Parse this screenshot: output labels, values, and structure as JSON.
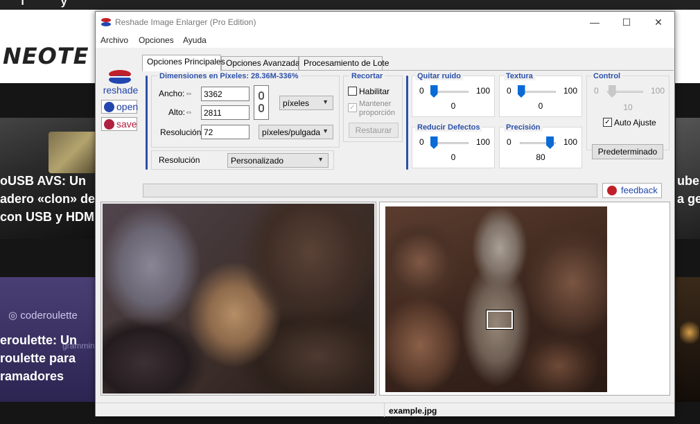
{
  "background": {
    "site_logo": "NEOTE",
    "social": "f y",
    "cards": [
      {
        "lines": [
          "oUSB AVS: Un",
          "adero «clon» de",
          "con USB y HDM"
        ]
      },
      {
        "brand": "coderoulette",
        "lines": [
          "eroulette: Un",
          "roulette para",
          "ramadores"
        ],
        "sub": "gramming game for dev"
      },
      {
        "lines": [
          "ube:",
          "a ger"
        ]
      }
    ]
  },
  "window": {
    "title": "Reshade Image Enlarger (Pro Edition)",
    "controls": {
      "minimize": "—",
      "maximize": "☐",
      "close": "✕"
    }
  },
  "menu": [
    "Archivo",
    "Opciones",
    "Ayuda"
  ],
  "sidebar": {
    "brand": "reshade",
    "open_label": "open",
    "save_label": "save"
  },
  "tabs": [
    "Opciones Principales",
    "Opciones Avanzadas",
    "Procesamiento de Lote"
  ],
  "dimensions": {
    "title": "Dimensiones en Píxeles:  28.36M-336%",
    "width_label": "Ancho:",
    "width_value": "3362",
    "height_label": "Alto:",
    "height_value": "2811",
    "resolution_label": "Resolución",
    "resolution_value": "72",
    "unit": "píxeles",
    "res_unit": "píxeles/pulgada",
    "preset_label": "Resolución",
    "preset_value": "Personalizado"
  },
  "crop": {
    "title": "Recortar",
    "enable_label": "Habilitar",
    "keep_label_1": "Mantener",
    "keep_label_2": "proporción",
    "restore_label": "Restaurar"
  },
  "sliders": [
    {
      "title": "Quitar ruido",
      "min": "0",
      "max": "100",
      "value": "0",
      "fraction": 0.0
    },
    {
      "title": "Textura",
      "min": "0",
      "max": "100",
      "value": "0",
      "fraction": 0.0
    },
    {
      "title": "Control",
      "min": "0",
      "max": "100",
      "value": "10",
      "fraction": 0.1
    },
    {
      "title": "Reducir Defectos",
      "min": "0",
      "max": "100",
      "value": "0",
      "fraction": 0.0
    },
    {
      "title": "Precisión",
      "min": "0",
      "max": "100",
      "value": "80",
      "fraction": 0.8
    }
  ],
  "control": {
    "auto_label": "Auto Ajuste",
    "default_label": "Predeterminado"
  },
  "feedback_label": "feedback",
  "status": {
    "filename": "example.jpg"
  }
}
